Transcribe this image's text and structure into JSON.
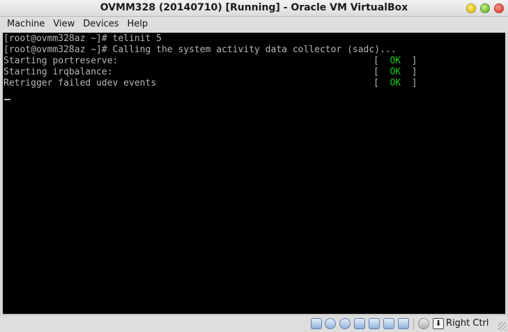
{
  "window": {
    "title": "OVMM328 (20140710) [Running] - Oracle VM VirtualBox"
  },
  "menu": {
    "items": [
      "Machine",
      "View",
      "Devices",
      "Help"
    ]
  },
  "console": {
    "lines": [
      "[root@ovmm328az ~]# telinit 5",
      "[root@ovmm328az ~]# Calling the system activity data collector (sadc)...",
      "Starting portreserve:",
      "Starting irqbalance:",
      "Retrigger failed udev events"
    ],
    "status_open": "[  ",
    "status_ok": "OK",
    "status_close": "  ]"
  },
  "statusbar": {
    "icons": [
      "hard-disk-icon",
      "optical-drive-icon",
      "usb-icon",
      "network-icon",
      "shared-folders-icon",
      "display-icon",
      "video-capture-icon",
      "mouse-integration-icon",
      "keyboard-capture-icon"
    ],
    "host_key": "Right Ctrl"
  },
  "colors": {
    "ok": "#18c818",
    "console_text": "#b7b7b7",
    "console_bg": "#000000"
  }
}
